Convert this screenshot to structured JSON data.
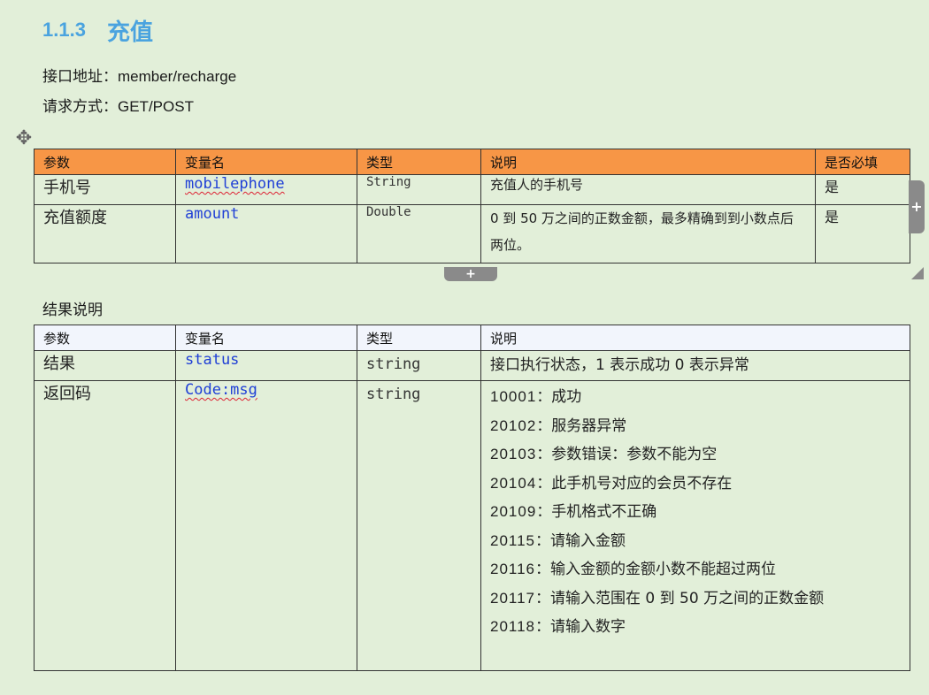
{
  "heading": {
    "number": "1.1.3",
    "title": "充值"
  },
  "meta": {
    "address_label": "接口地址：",
    "address_value": "member/recharge",
    "method_label": "请求方式：",
    "method_value": "GET/POST"
  },
  "params_table": {
    "headers": [
      "参数",
      "变量名",
      "类型",
      "说明",
      "是否必填"
    ],
    "rows": [
      {
        "param": "手机号",
        "var": "mobilephone",
        "type": "String",
        "desc": "充值人的手机号",
        "required": "是"
      },
      {
        "param": "充值额度",
        "var": "amount",
        "type": "Double",
        "desc": "0 到 50 万之间的正数金额，最多精确到到小数点后两位。",
        "required": "是"
      }
    ]
  },
  "results_label": "结果说明",
  "results_table": {
    "headers": [
      "参数",
      "变量名",
      "类型",
      "说明"
    ],
    "rows": [
      {
        "param": "结果",
        "var": "status",
        "type": "string",
        "desc": "接口执行状态，1 表示成功 0 表示异常"
      },
      {
        "param": "返回码",
        "var": "Code:msg",
        "type": "string"
      }
    ],
    "codes": [
      {
        "code": "10001",
        "msg": "：成功"
      },
      {
        "code": "20102",
        "msg": "：服务器异常"
      },
      {
        "code": "20103",
        "msg": "：参数错误：参数不能为空"
      },
      {
        "code": "20104",
        "msg": "：此手机号对应的会员不存在"
      },
      {
        "code": "20109",
        "msg": "：手机格式不正确"
      },
      {
        "code": "20115",
        "msg": "：请输入金额"
      },
      {
        "code": "20116",
        "msg": "：输入金额的金额小数不能超过两位"
      },
      {
        "code": "20117",
        "msg": "：请输入范围在 0 到 50 万之间的正数金额"
      },
      {
        "code": "20118",
        "msg": "：请输入数字"
      }
    ]
  },
  "editor": {
    "move_glyph": "✥",
    "add_glyph": "+"
  }
}
